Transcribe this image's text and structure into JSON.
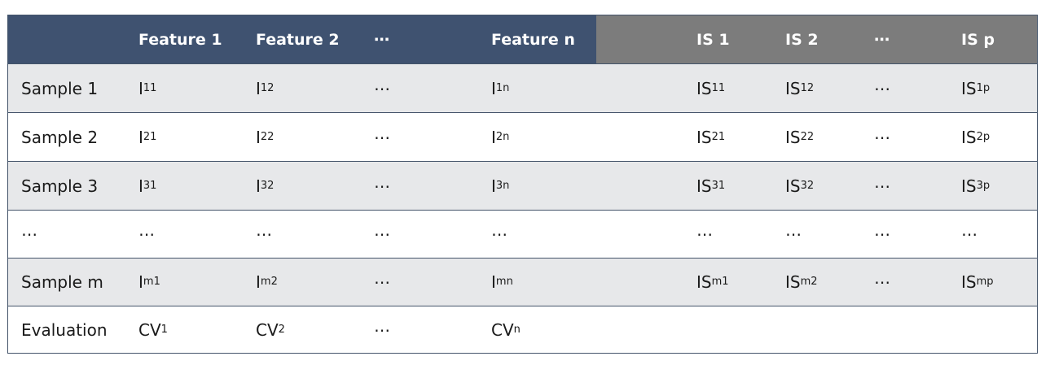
{
  "header": [
    "",
    "Feature 1",
    "Feature 2",
    "⋯",
    "Feature n",
    "IS 1",
    "IS 2",
    "⋯",
    "IS p"
  ],
  "rows": [
    {
      "label": "Sample 1",
      "cells": [
        {
          "base": "I",
          "sub": "11"
        },
        {
          "base": "I",
          "sub": "12"
        },
        {
          "base": "⋯",
          "sub": ""
        },
        {
          "base": "I",
          "sub": "1n"
        },
        {
          "base": "IS",
          "sub": "11"
        },
        {
          "base": "IS",
          "sub": "12"
        },
        {
          "base": "⋯",
          "sub": ""
        },
        {
          "base": "IS",
          "sub": "1p"
        }
      ]
    },
    {
      "label": "Sample 2",
      "cells": [
        {
          "base": "I",
          "sub": "21"
        },
        {
          "base": "I",
          "sub": "22"
        },
        {
          "base": "⋯",
          "sub": ""
        },
        {
          "base": "I",
          "sub": "2n"
        },
        {
          "base": "IS",
          "sub": "21"
        },
        {
          "base": "IS",
          "sub": "22"
        },
        {
          "base": "⋯",
          "sub": ""
        },
        {
          "base": "IS",
          "sub": "2p"
        }
      ]
    },
    {
      "label": "Sample 3",
      "cells": [
        {
          "base": "I",
          "sub": "31"
        },
        {
          "base": "I",
          "sub": "32"
        },
        {
          "base": "⋯",
          "sub": ""
        },
        {
          "base": "I",
          "sub": "3n"
        },
        {
          "base": "IS",
          "sub": "31"
        },
        {
          "base": "IS",
          "sub": "32"
        },
        {
          "base": "⋯",
          "sub": ""
        },
        {
          "base": "IS",
          "sub": "3p"
        }
      ]
    },
    {
      "label": "⋯",
      "cells": [
        {
          "base": "⋯",
          "sub": ""
        },
        {
          "base": "⋯",
          "sub": ""
        },
        {
          "base": "⋯",
          "sub": ""
        },
        {
          "base": "⋯",
          "sub": ""
        },
        {
          "base": "⋯",
          "sub": ""
        },
        {
          "base": "⋯",
          "sub": ""
        },
        {
          "base": "⋯",
          "sub": ""
        },
        {
          "base": "⋯",
          "sub": ""
        }
      ]
    },
    {
      "label": "Sample m",
      "cells": [
        {
          "base": "I",
          "sub": "m1"
        },
        {
          "base": "I",
          "sub": "m2"
        },
        {
          "base": "⋯",
          "sub": ""
        },
        {
          "base": "I",
          "sub": "mn"
        },
        {
          "base": "IS",
          "sub": "m1"
        },
        {
          "base": "IS",
          "sub": "m2"
        },
        {
          "base": "⋯",
          "sub": ""
        },
        {
          "base": "IS",
          "sub": "mp"
        }
      ]
    },
    {
      "label": "Evaluation",
      "cells": [
        {
          "base": "CV",
          "sub": "1"
        },
        {
          "base": "CV",
          "sub": "2"
        },
        {
          "base": "⋯",
          "sub": ""
        },
        {
          "base": "CV",
          "sub": "n"
        },
        {
          "base": "",
          "sub": ""
        },
        {
          "base": "",
          "sub": ""
        },
        {
          "base": "",
          "sub": ""
        },
        {
          "base": "",
          "sub": ""
        }
      ]
    }
  ],
  "colors": {
    "header_features_bg": "#3f5270",
    "header_is_bg": "#7c7c7c",
    "shaded_row_bg": "#e7e8ea",
    "border": "#44546a"
  }
}
